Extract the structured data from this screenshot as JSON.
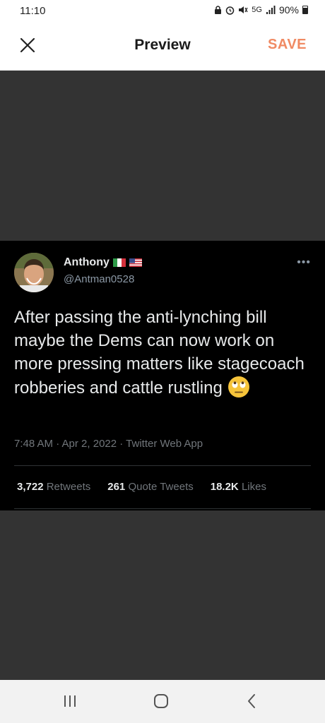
{
  "status_bar": {
    "time": "11:10",
    "network": "5G",
    "battery": "90%"
  },
  "app_bar": {
    "title": "Preview",
    "save_label": "SAVE"
  },
  "tweet": {
    "display_name": "Anthony",
    "handle": "@Antman0528",
    "more_label": "•••",
    "text": "After passing the anti-lynching bill maybe the Dems can now work on more pressing matters like stagecoach robberies and cattle rustling",
    "timestamp": "7:48 AM · Apr 2, 2022 · Twitter Web App",
    "retweets_count": "3,722",
    "retweets_label": "Retweets",
    "quotes_count": "261",
    "quotes_label": "Quote Tweets",
    "likes_count": "18.2K",
    "likes_label": "Likes"
  },
  "icons": [
    "close-icon",
    "italy-flag-icon",
    "usa-flag-icon",
    "eye-roll-emoji",
    "recents-icon",
    "home-icon",
    "back-icon"
  ],
  "colors": {
    "accent": "#f08a63",
    "tweet_bg": "#000000",
    "backdrop": "#333333"
  }
}
